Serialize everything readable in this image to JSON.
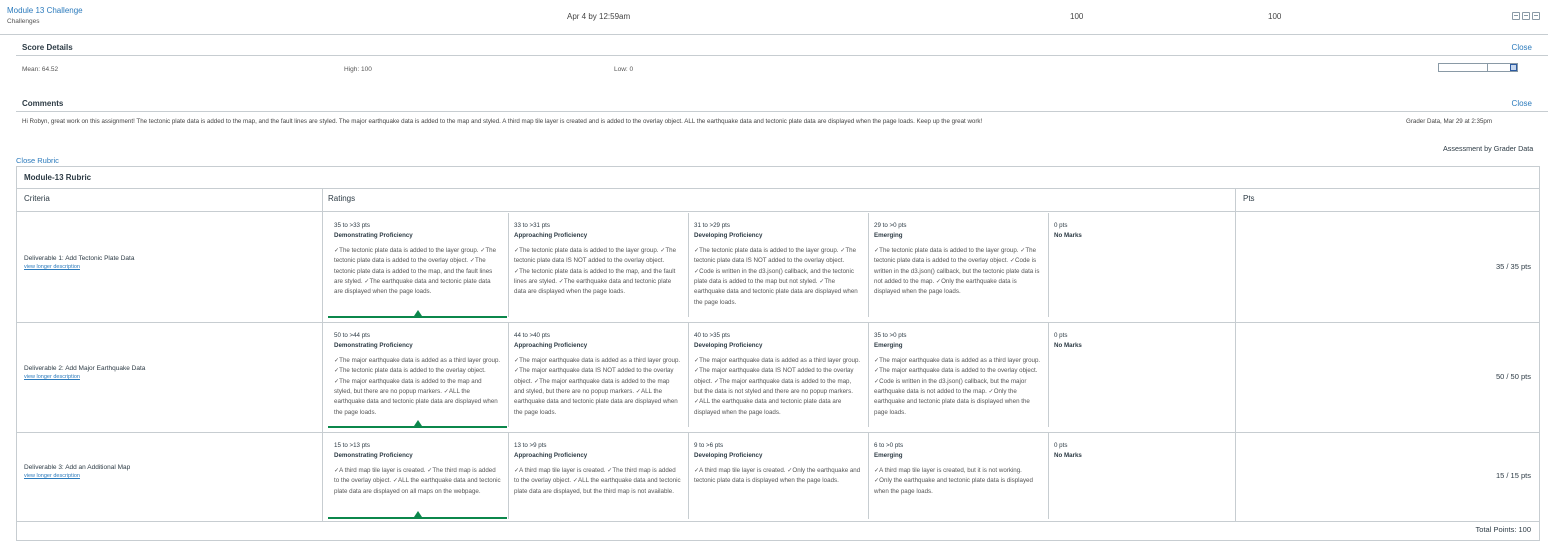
{
  "assignment": {
    "title": "Module 13 Challenge",
    "group": "Challenges",
    "due": "Apr 4 by 12:59am",
    "score": "100",
    "out_of": "100"
  },
  "score_details": {
    "title": "Score Details",
    "close_label": "Close",
    "mean": "Mean: 64.52",
    "high": "High: 100",
    "low": "Low: 0"
  },
  "comments": {
    "title": "Comments",
    "close_label": "Close",
    "text": "Hi Robyn, great work on this assignment! The tectonic plate data is added to the map, and the fault lines are styled. The major earthquake data is added to the map and styled. A third map tile layer is created and is added to the overlay object. ALL the earthquake data and tectonic plate data are displayed when the page loads. Keep up the great work!",
    "meta": "Grader Data, Mar 29 at 2:35pm"
  },
  "assessed_by": "Assessment by Grader Data",
  "close_rubric_label": "Close Rubric",
  "rubric": {
    "title": "Module-13 Rubric",
    "headers": {
      "criteria": "Criteria",
      "ratings": "Ratings",
      "pts": "Pts"
    },
    "view_longer": "view longer description",
    "rows": [
      {
        "criterion": "Deliverable 1: Add Tectonic Plate Data",
        "points": "35 / 35 pts",
        "ratings": [
          {
            "pts": "35 to >33 pts",
            "label": "Demonstrating Proficiency",
            "desc": "✓The tectonic plate data is added to the layer group. ✓The tectonic plate data is added to the overlay object. ✓The tectonic plate data is added to the map, and the fault lines are styled. ✓The earthquake data and tectonic plate data are displayed when the page loads."
          },
          {
            "pts": "33 to >31 pts",
            "label": "Approaching Proficiency",
            "desc": "✓The tectonic plate data is added to the layer group. ✓The tectonic plate data IS NOT added to the overlay object. ✓The tectonic plate data is added to the map, and the fault lines are styled. ✓The earthquake data and tectonic plate data are displayed when the page loads."
          },
          {
            "pts": "31 to >29 pts",
            "label": "Developing Proficiency",
            "desc": "✓The tectonic plate data is added to the layer group. ✓The tectonic plate data IS NOT added to the overlay object. ✓Code is written in the d3.json() callback, and the tectonic plate data is added to the map but not styled. ✓The earthquake data and tectonic plate data are displayed when the page loads."
          },
          {
            "pts": "29 to >0 pts",
            "label": "Emerging",
            "desc": "✓The tectonic plate data is added to the layer group. ✓The tectonic plate data is added to the overlay object. ✓Code is written in the d3.json() callback, but the tectonic plate data is not added to the map. ✓Only the earthquake data is displayed when the page loads."
          },
          {
            "pts": "0 pts",
            "label": "No Marks",
            "desc": ""
          }
        ]
      },
      {
        "criterion": "Deliverable 2: Add Major Earthquake Data",
        "points": "50 / 50 pts",
        "ratings": [
          {
            "pts": "50 to >44 pts",
            "label": "Demonstrating Proficiency",
            "desc": "✓The major earthquake data is added as a third layer group. ✓The tectonic plate data is added to the overlay object. ✓The major earthquake data is added to the map and styled, but there are no popup markers. ✓ALL the earthquake data and tectonic plate data are displayed when the page loads."
          },
          {
            "pts": "44 to >40 pts",
            "label": "Approaching Proficiency",
            "desc": "✓The major earthquake data is added as a third layer group. ✓The major earthquake data IS NOT added to the overlay object. ✓The major earthquake data is added to the map and styled, but there are no popup markers. ✓ALL the earthquake data and tectonic plate data are displayed when the page loads."
          },
          {
            "pts": "40 to >35 pts",
            "label": "Developing Proficiency",
            "desc": "✓The major earthquake data is added as a third layer group. ✓The major earthquake data IS NOT added to the overlay object. ✓The major earthquake data is added to the map, but the data is not styled and there are no popup markers. ✓ALL the earthquake data and tectonic plate data are displayed when the page loads."
          },
          {
            "pts": "35 to >0 pts",
            "label": "Emerging",
            "desc": "✓The major earthquake data is added as a third layer group. ✓The major earthquake data is added to the overlay object. ✓Code is written in the d3.json() callback, but the major earthquake data is not added to the map. ✓Only the earthquake and tectonic plate data is displayed when the page loads."
          },
          {
            "pts": "0 pts",
            "label": "No Marks",
            "desc": ""
          }
        ]
      },
      {
        "criterion": "Deliverable 3: Add an Additional Map",
        "points": "15 / 15 pts",
        "ratings": [
          {
            "pts": "15 to >13 pts",
            "label": "Demonstrating Proficiency",
            "desc": "✓A third map tile layer is created. ✓The third map is added to the overlay object. ✓ALL the earthquake data and tectonic plate data are displayed on all maps on the webpage."
          },
          {
            "pts": "13 to >9 pts",
            "label": "Approaching Proficiency",
            "desc": "✓A third map tile layer is created. ✓The third map is added to the overlay object. ✓ALL the earthquake data and tectonic plate data are displayed, but the third map is not available."
          },
          {
            "pts": "9 to >6 pts",
            "label": "Developing Proficiency",
            "desc": "✓A third map tile layer is created. ✓Only the earthquake and tectonic plate data is displayed when the page loads."
          },
          {
            "pts": "6 to >0 pts",
            "label": "Emerging",
            "desc": "✓A third map tile layer is created, but it is not working. ✓Only the earthquake and tectonic plate data is displayed when the page loads."
          },
          {
            "pts": "0 pts",
            "label": "No Marks",
            "desc": ""
          }
        ]
      }
    ],
    "total": "Total Points: 100"
  }
}
